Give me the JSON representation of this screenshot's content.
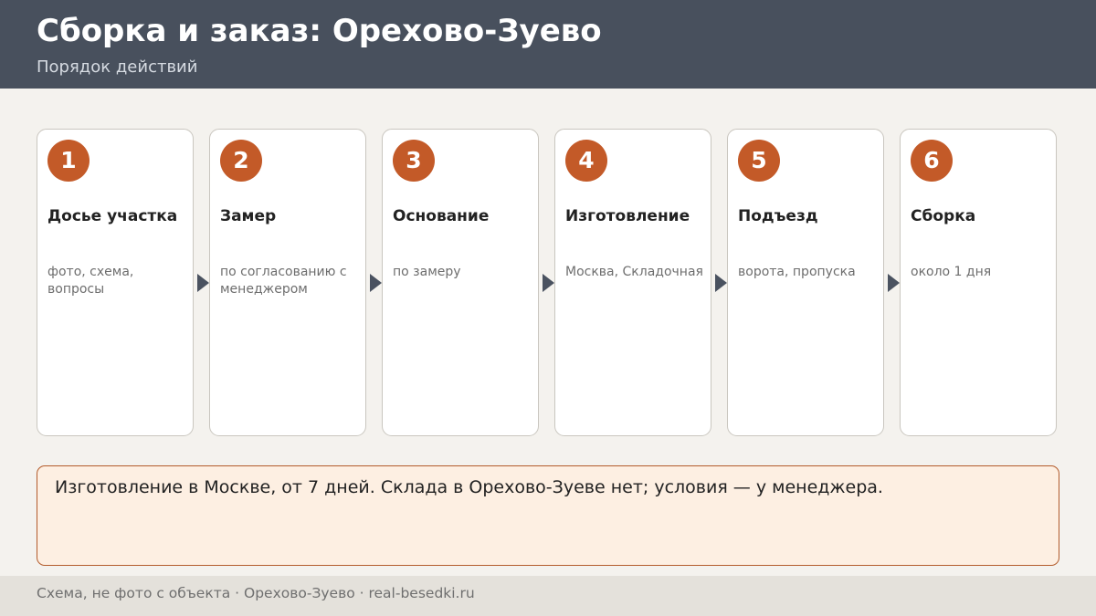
{
  "header": {
    "title": "Сборка и заказ: Орехово-Зуево",
    "subtitle": "Порядок действий"
  },
  "steps": [
    {
      "number": "1",
      "title": "Досье участка",
      "desc": "фото, схема, вопросы"
    },
    {
      "number": "2",
      "title": "Замер",
      "desc": "по согласованию с менеджером"
    },
    {
      "number": "3",
      "title": "Основание",
      "desc": "по замеру"
    },
    {
      "number": "4",
      "title": "Изготовление",
      "desc": "Москва, Складочная"
    },
    {
      "number": "5",
      "title": "Подъезд",
      "desc": "ворота, пропуска"
    },
    {
      "number": "6",
      "title": "Сборка",
      "desc": "около 1 дня"
    }
  ],
  "note": {
    "text": "Изготовление в Москве, от 7 дней. Склада в Орехово-Зуеве нет; условия — у менеджера."
  },
  "footer": {
    "text": "Схема, не фото с объекта  ·  Орехово-Зуево  ·  real-besedki.ru"
  },
  "colors": {
    "header_bg": "#48505d",
    "accent": "#c35a28",
    "note_bg": "#fdefe2",
    "note_border": "#b35c2c"
  }
}
